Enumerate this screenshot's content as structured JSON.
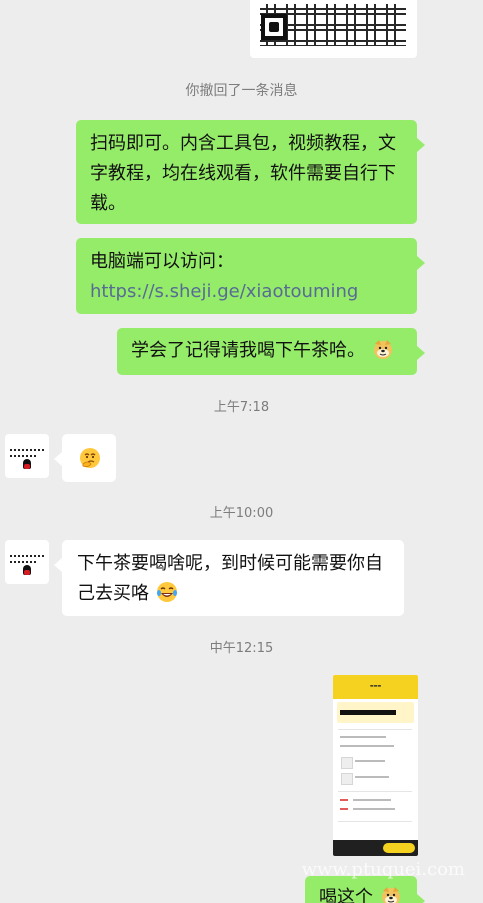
{
  "system": {
    "recall": "你撤回了一条消息"
  },
  "times": [
    "上午7:18",
    "上午10:00",
    "中午12:15"
  ],
  "messages": {
    "m1": "扫码即可。内含工具包，视频教程，文字教程，均在线观看，软件需要自行下载。",
    "m2_prefix": "电脑端可以访问：",
    "m2_link": "https://s.sheji.ge/xiaotouming",
    "m3": "学会了记得请我喝下午茶哈。",
    "m4": "下午茶要喝啥呢，到时候可能需要你自己去买咯",
    "m5": "喝这个"
  },
  "watermark": "www.ptuquei.com",
  "colors": {
    "green": "#95ec69",
    "link": "#576b95",
    "receipt_yellow": "#f5d21f"
  }
}
